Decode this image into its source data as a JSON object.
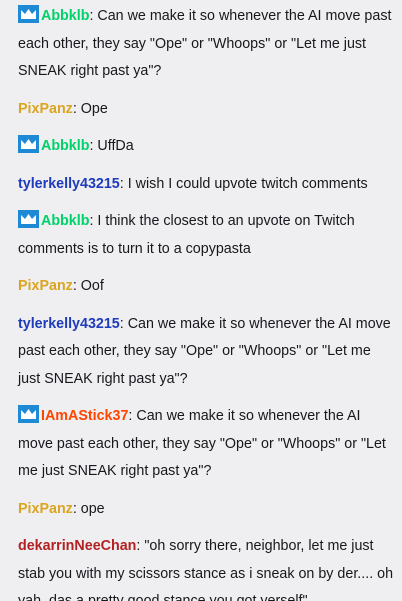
{
  "colors": {
    "background": "#efeef1",
    "text": "#19171c",
    "badge_blue": "#1e8ad6",
    "user_green": "#00d26a",
    "user_gold": "#daa520",
    "user_blue": "#1e3cba",
    "user_orange": "#ff4500",
    "user_brown": "#b22222"
  },
  "messages": [
    {
      "badge": "crown-badge-icon",
      "user": "Abbklb",
      "color": "#00d26a",
      "colon": ":",
      "text": " Can we make it so whenever the AI move past each other, they say \"Ope\" or \"Whoops\" or \"Let me just SNEAK right past ya\"?"
    },
    {
      "badge": null,
      "user": "PixPanz",
      "color": "#daa520",
      "colon": ":",
      "text": " Ope"
    },
    {
      "badge": "crown-badge-icon",
      "user": "Abbklb",
      "color": "#00d26a",
      "colon": ":",
      "text": " UffDa"
    },
    {
      "badge": null,
      "user": "tylerkelly43215",
      "color": "#1e3cba",
      "colon": ":",
      "text": " I wish I could upvote twitch comments"
    },
    {
      "badge": "crown-badge-icon",
      "user": "Abbklb",
      "color": "#00d26a",
      "colon": ":",
      "text": " I think the closest to an upvote on Twitch comments is to turn it to a copypasta"
    },
    {
      "badge": null,
      "user": "PixPanz",
      "color": "#daa520",
      "colon": ":",
      "text": " Oof"
    },
    {
      "badge": null,
      "user": "tylerkelly43215",
      "color": "#1e3cba",
      "colon": ":",
      "text": " Can we make it so whenever the AI move past each other, they say \"Ope\" or \"Whoops\" or \"Let me just SNEAK right past ya\"?"
    },
    {
      "badge": "crown-badge-icon",
      "user": "IAmAStick37",
      "color": "#ff4500",
      "colon": ":",
      "text": " Can we make it so whenever the AI move past each other, they say \"Ope\" or \"Whoops\" or \"Let me just SNEAK right past ya\"?"
    },
    {
      "badge": null,
      "user": "PixPanz",
      "color": "#daa520",
      "colon": ":",
      "text": " ope"
    },
    {
      "badge": null,
      "user": "dekarrinNeeChan",
      "color": "#b22222",
      "colon": ":",
      "text": " \"oh sorry there, neighbor, let me just stab you with my scissors stance as i sneak on by der.... oh yah, das a pretty good stance you got yerself\""
    }
  ]
}
